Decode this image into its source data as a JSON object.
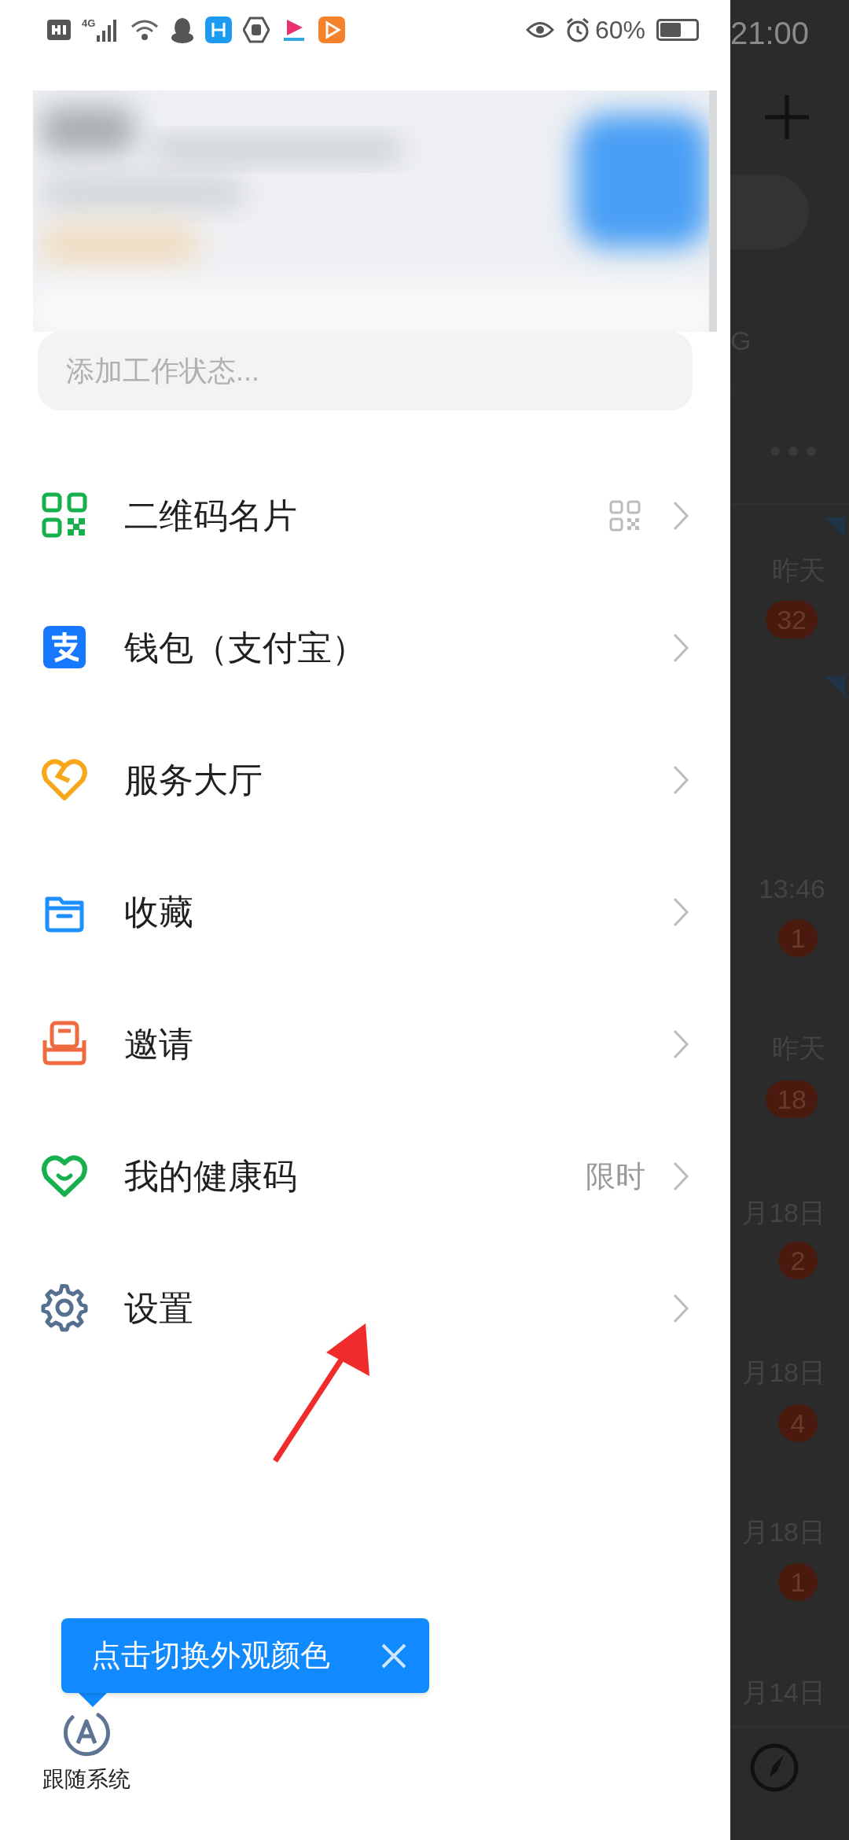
{
  "status_bar": {
    "network": "4G",
    "battery": "60%",
    "time": "21:00"
  },
  "status_field": {
    "placeholder": "添加工作状态..."
  },
  "menu": [
    {
      "label": "二维码名片",
      "kind": "card"
    },
    {
      "label": "钱包（支付宝）",
      "kind": "plain"
    },
    {
      "label": "服务大厅",
      "kind": "plain"
    },
    {
      "label": "收藏",
      "kind": "plain"
    },
    {
      "label": "邀请",
      "kind": "plain"
    },
    {
      "label": "我的健康码",
      "kind": "plain",
      "note": "限时"
    },
    {
      "label": "设置",
      "kind": "plain"
    }
  ],
  "tooltip": {
    "text": "点击切换外观颜色"
  },
  "theme_button": {
    "label": "跟随系统"
  },
  "background": {
    "header_text": "G",
    "chats": [
      {
        "time": "昨天",
        "badge": "32"
      },
      {
        "time": "13:46",
        "badge": "1"
      },
      {
        "time": "昨天",
        "badge": "18"
      },
      {
        "time": "月18日",
        "badge": "2"
      },
      {
        "time": "月18日",
        "badge": "4"
      },
      {
        "time": "月18日",
        "badge": "1"
      },
      {
        "time": "月14日"
      }
    ]
  }
}
